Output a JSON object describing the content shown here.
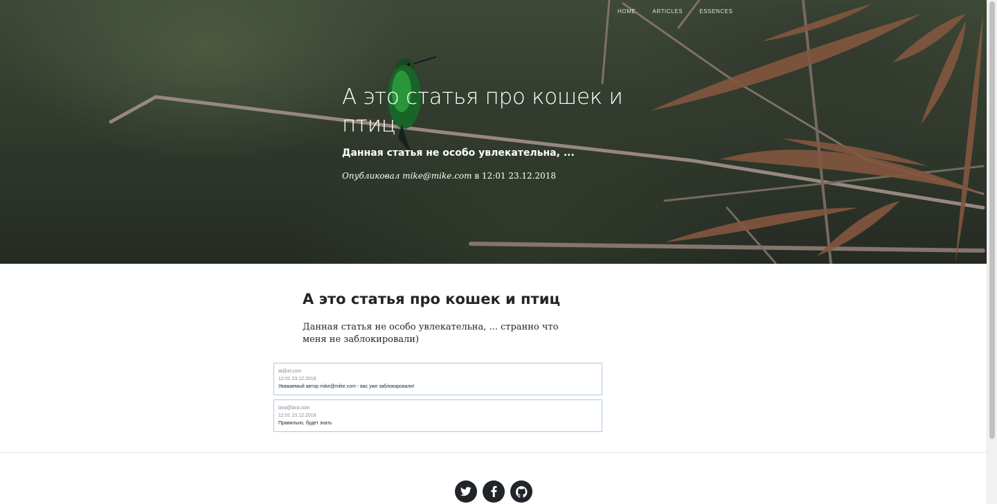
{
  "nav": {
    "items": [
      {
        "label": "HOME"
      },
      {
        "label": "ARTICLES"
      },
      {
        "label": "ESSENCES"
      }
    ]
  },
  "hero": {
    "title": "А это статья про кошек и птиц",
    "subtitle": "Данная статья не особо увлекательна, ...",
    "meta_by": "Опубликовал mike@mike.com",
    "meta_at": " в 12:01 23.12.2018"
  },
  "article": {
    "title": "А это статья про кошек и птиц",
    "body": "Данная статья не особо увлекательна, ... странно что меня не заблокировали)"
  },
  "comments": [
    {
      "author": "al@al.com",
      "date": "12:01 23.12.2018",
      "text": "Уважаемый автор mike@mike.com - вас уже заблокировали!"
    },
    {
      "author": "lara@lara.com",
      "date": "12:01 23.12.2018",
      "text": "Правильно, будет знать"
    }
  ],
  "social": {
    "icons": [
      "twitter-icon",
      "facebook-icon",
      "github-icon"
    ]
  }
}
